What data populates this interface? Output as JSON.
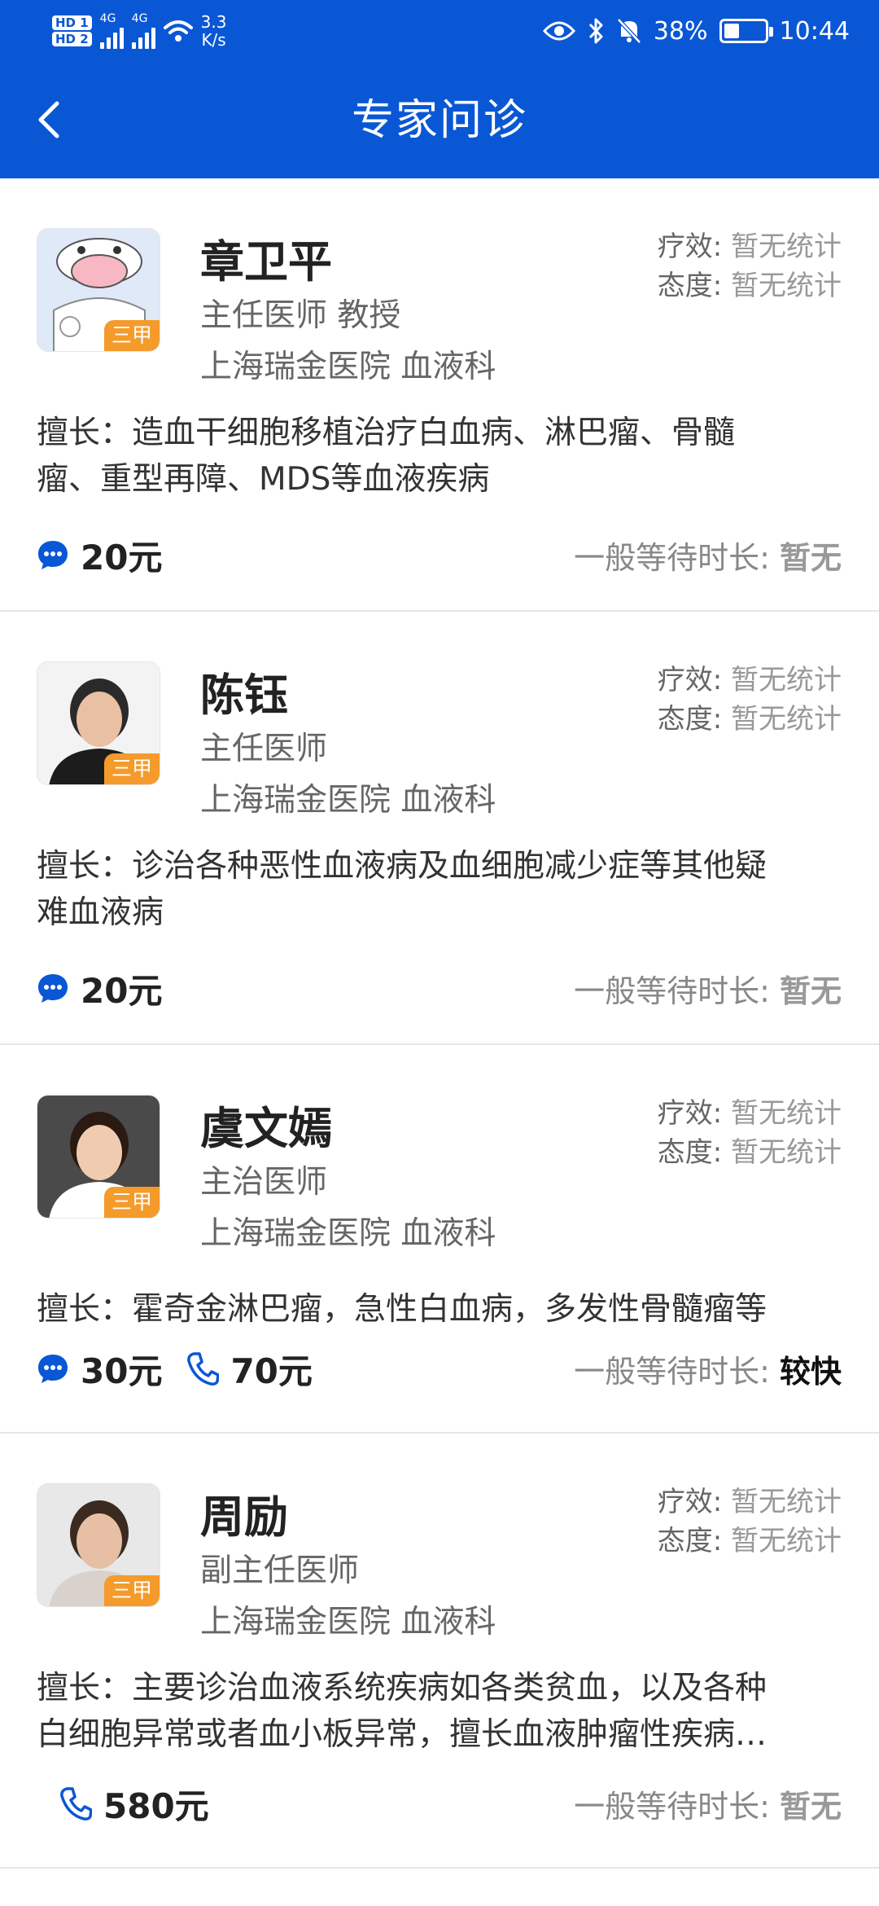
{
  "status_bar": {
    "sim1": "HD 1",
    "sim2": "HD 2",
    "net1": "4G",
    "net2": "4G",
    "speed_value": "3.3",
    "speed_unit": "K/s",
    "battery": "38%",
    "battery_level": 0.38,
    "time": "10:44"
  },
  "nav": {
    "title": "专家问诊"
  },
  "doctors": [
    {
      "name": "章卫平",
      "title": "主任医师 教授",
      "hospital": "上海瑞金医院 血液科",
      "badge": "三甲",
      "efficacy_label": "疗效:",
      "efficacy_value": "暂无统计",
      "attitude_label": "态度:",
      "attitude_value": "暂无统计",
      "expertise_line1": "擅长：造血干细胞移植治疗白血病、淋巴瘤、骨髓",
      "expertise_line2": "瘤、重型再障、MDS等血液疾病",
      "chat_price": "20元",
      "phone_price": "",
      "wait_label": "一般等待时长:",
      "wait_value": "暂无",
      "avatar_icon": "cartoon-cow-doctor-avatar"
    },
    {
      "name": "陈钰",
      "title": "主任医师",
      "hospital": "上海瑞金医院 血液科",
      "badge": "三甲",
      "efficacy_label": "疗效:",
      "efficacy_value": "暂无统计",
      "attitude_label": "态度:",
      "attitude_value": "暂无统计",
      "expertise_line1": "擅长：诊治各种恶性血液病及血细胞减少症等其他疑",
      "expertise_line2": "难血液病",
      "chat_price": "20元",
      "phone_price": "",
      "wait_label": "一般等待时长:",
      "wait_value": "暂无",
      "avatar_icon": "doctor-photo-avatar"
    },
    {
      "name": "虞文嫣",
      "title": "主治医师",
      "hospital": "上海瑞金医院 血液科",
      "badge": "三甲",
      "efficacy_label": "疗效:",
      "efficacy_value": "暂无统计",
      "attitude_label": "态度:",
      "attitude_value": "暂无统计",
      "expertise_line1": "擅长：霍奇金淋巴瘤，急性白血病，多发性骨髓瘤等",
      "expertise_line2": "",
      "chat_price": "30元",
      "phone_price": "70元",
      "wait_label": "一般等待时长:",
      "wait_value": "较快",
      "avatar_icon": "doctor-photo-avatar"
    },
    {
      "name": "周励",
      "title": "副主任医师",
      "hospital": "上海瑞金医院 血液科",
      "badge": "三甲",
      "efficacy_label": "疗效:",
      "efficacy_value": "暂无统计",
      "attitude_label": "态度:",
      "attitude_value": "暂无统计",
      "expertise_line1": "擅长：主要诊治血液系统疾病如各类贫血，以及各种",
      "expertise_line2": "白细胞异常或者血小板异常，擅长血液肿瘤性疾病…",
      "chat_price": "",
      "phone_price": "580元",
      "wait_label": "一般等待时长:",
      "wait_value": "暂无",
      "avatar_icon": "doctor-photo-avatar"
    }
  ],
  "colors": {
    "brand": "#0a57d6",
    "badge": "#f49b2c"
  }
}
